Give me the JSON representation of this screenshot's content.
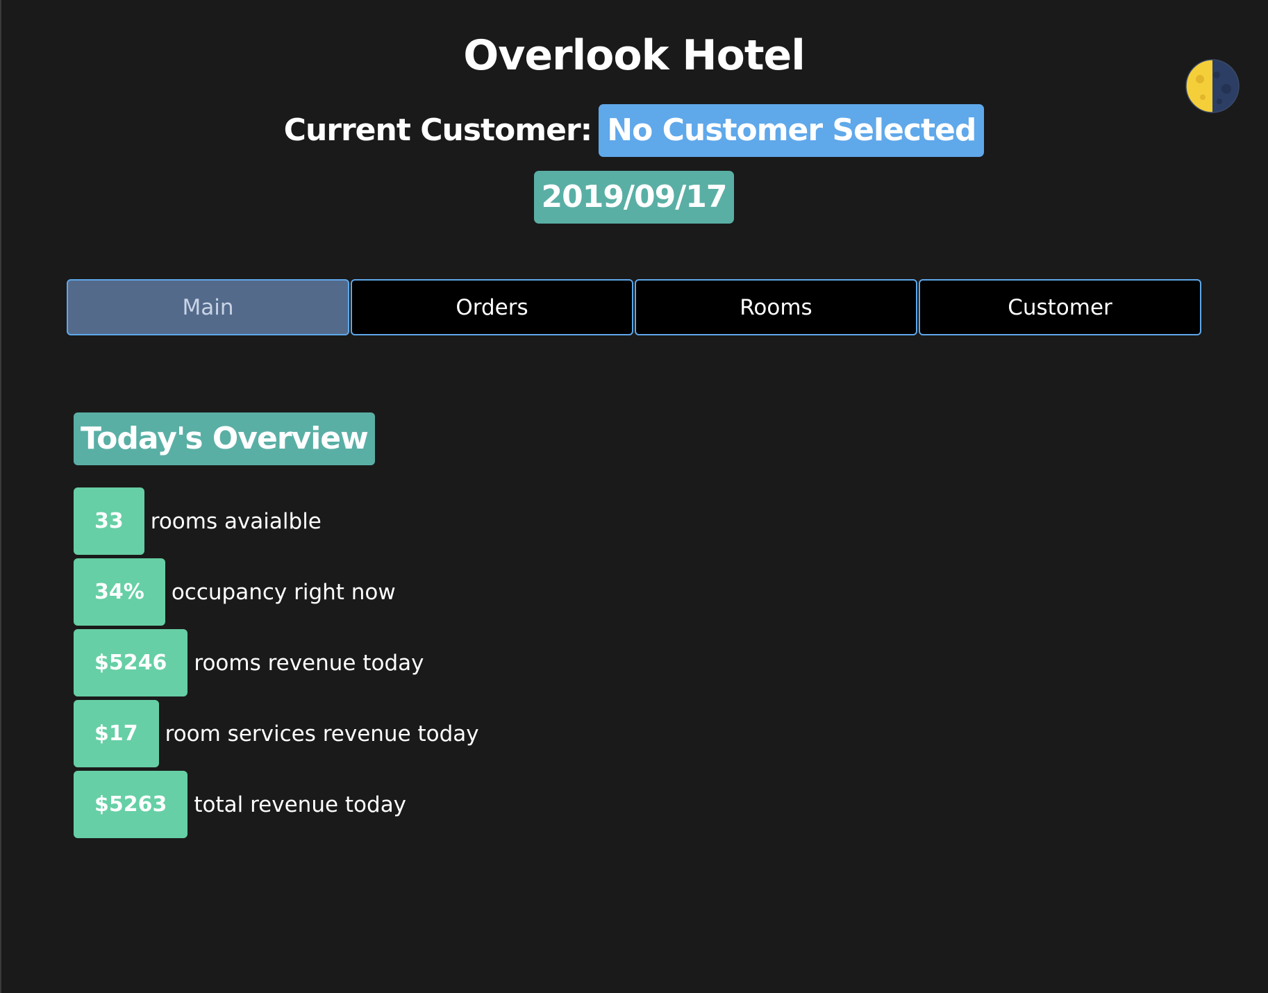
{
  "app": {
    "title": "Overlook Hotel",
    "theme_toggle_icon": "moon-icon"
  },
  "customer": {
    "label": "Current Customer:",
    "value": "No Customer Selected"
  },
  "date": "2019/09/17",
  "tabs": [
    {
      "label": "Main",
      "active": true
    },
    {
      "label": "Orders",
      "active": false
    },
    {
      "label": "Rooms",
      "active": false
    },
    {
      "label": "Customer",
      "active": false
    }
  ],
  "overview": {
    "heading": "Today's Overview",
    "stats": [
      {
        "value": "33",
        "label": "rooms avaialble"
      },
      {
        "value": "34%",
        "label": "occupancy right now"
      },
      {
        "value": "$5246",
        "label": "rooms revenue today"
      },
      {
        "value": "$17",
        "label": "room services revenue today"
      },
      {
        "value": "$5263",
        "label": "total revenue today"
      }
    ]
  },
  "colors": {
    "background": "#1a1a1a",
    "customer_badge": "#5fa8ea",
    "date_badge": "#5aafa5",
    "tab_border": "#5fa8ea",
    "tab_active": "#536a8b",
    "stat_badge": "#66cfa5"
  }
}
